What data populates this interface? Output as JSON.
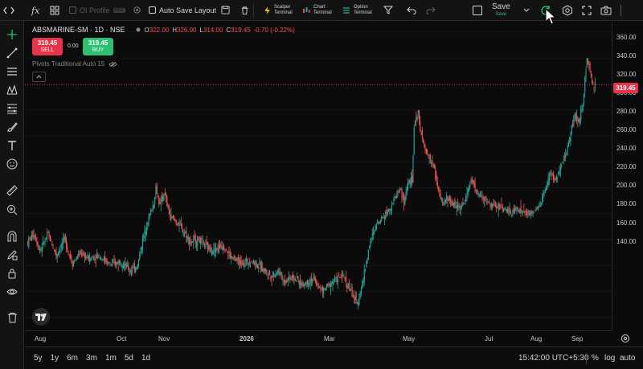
{
  "toolbar": {
    "oi_profile_label": "OI Profile",
    "oi_profile_badge": "new",
    "auto_save_label": "Auto Save Layout",
    "scalper_label": "Scalper Terminal",
    "chart_label": "Chart Terminal",
    "option_label": "Option Terminal",
    "save_label": "Save",
    "save_sub": "Save"
  },
  "legend": {
    "symbol": "ABSMARINE-SM · 1D · NSE",
    "open_label": "O",
    "open": "322.00",
    "high_label": "H",
    "high": "326.00",
    "low_label": "L",
    "low": "314.00",
    "close_label": "C",
    "close": "319.45",
    "change": "-0.70 (-0.22%)",
    "indicator": "Pivots Traditional Auto 15"
  },
  "trade": {
    "sell_price": "319.45",
    "sell_label": "SELL",
    "spread": "0.00",
    "buy_price": "319.45",
    "buy_label": "BUY"
  },
  "price_axis": {
    "ticks": [
      "360.00",
      "340.00",
      "320.00",
      "300.00",
      "280.00",
      "260.00",
      "240.00",
      "220.00",
      "200.00",
      "180.00",
      "160.00",
      "140.00"
    ],
    "last_price": "319.45"
  },
  "time_axis": {
    "ticks": [
      "Aug",
      "Oct",
      "Nov",
      "2026",
      "Mar",
      "May",
      "Jul",
      "Aug",
      "Sep"
    ]
  },
  "bottom": {
    "ranges": [
      "5y",
      "1y",
      "6m",
      "3m",
      "1m",
      "5d",
      "1d"
    ],
    "time": "15:42:00 UTC+5:30",
    "percent": "%",
    "log": "log",
    "auto": "auto"
  },
  "colors": {
    "up": "#26a69a",
    "down": "#ef5350",
    "sell": "#e8334a",
    "buy": "#2fbf71",
    "last_line": "#e8334a",
    "accent": "#2fbf71"
  },
  "chart_data": {
    "type": "candlestick",
    "y_range": [
      130,
      368
    ],
    "last_price": 319.45,
    "close_path": [
      [
        0,
        198
      ],
      [
        6,
        205
      ],
      [
        12,
        192
      ],
      [
        20,
        204
      ],
      [
        28,
        188
      ],
      [
        36,
        200
      ],
      [
        44,
        182
      ],
      [
        52,
        190
      ],
      [
        60,
        185
      ],
      [
        70,
        188
      ],
      [
        82,
        180
      ],
      [
        92,
        184
      ],
      [
        100,
        176
      ],
      [
        108,
        180
      ],
      [
        112,
        196
      ],
      [
        118,
        215
      ],
      [
        124,
        228
      ],
      [
        126,
        240
      ],
      [
        130,
        226
      ],
      [
        134,
        236
      ],
      [
        140,
        218
      ],
      [
        148,
        212
      ],
      [
        154,
        206
      ],
      [
        160,
        198
      ],
      [
        168,
        200
      ],
      [
        176,
        194
      ],
      [
        184,
        192
      ],
      [
        192,
        196
      ],
      [
        200,
        186
      ],
      [
        210,
        182
      ],
      [
        220,
        184
      ],
      [
        230,
        178
      ],
      [
        240,
        172
      ],
      [
        246,
        176
      ],
      [
        252,
        168
      ],
      [
        260,
        172
      ],
      [
        270,
        165
      ],
      [
        280,
        170
      ],
      [
        290,
        160
      ],
      [
        300,
        168
      ],
      [
        310,
        172
      ],
      [
        318,
        160
      ],
      [
        324,
        150
      ],
      [
        330,
        170
      ],
      [
        336,
        196
      ],
      [
        344,
        214
      ],
      [
        352,
        220
      ],
      [
        360,
        230
      ],
      [
        366,
        240
      ],
      [
        370,
        228
      ],
      [
        374,
        245
      ],
      [
        378,
        244
      ],
      [
        380,
        288
      ],
      [
        384,
        298
      ],
      [
        388,
        276
      ],
      [
        392,
        266
      ],
      [
        396,
        262
      ],
      [
        400,
        254
      ],
      [
        404,
        238
      ],
      [
        408,
        226
      ],
      [
        412,
        232
      ],
      [
        420,
        226
      ],
      [
        428,
        226
      ],
      [
        436,
        246
      ],
      [
        442,
        236
      ],
      [
        450,
        230
      ],
      [
        456,
        226
      ],
      [
        466,
        226
      ],
      [
        474,
        220
      ],
      [
        482,
        224
      ],
      [
        490,
        220
      ],
      [
        496,
        220
      ],
      [
        502,
        224
      ],
      [
        506,
        232
      ],
      [
        510,
        240
      ],
      [
        514,
        252
      ],
      [
        518,
        246
      ],
      [
        522,
        250
      ],
      [
        526,
        258
      ],
      [
        530,
        268
      ],
      [
        534,
        284
      ],
      [
        538,
        296
      ],
      [
        542,
        290
      ],
      [
        544,
        300
      ],
      [
        546,
        304
      ],
      [
        548,
        326
      ],
      [
        550,
        338
      ],
      [
        552,
        334
      ],
      [
        554,
        326
      ],
      [
        556,
        320
      ],
      [
        558,
        319.45
      ]
    ]
  }
}
